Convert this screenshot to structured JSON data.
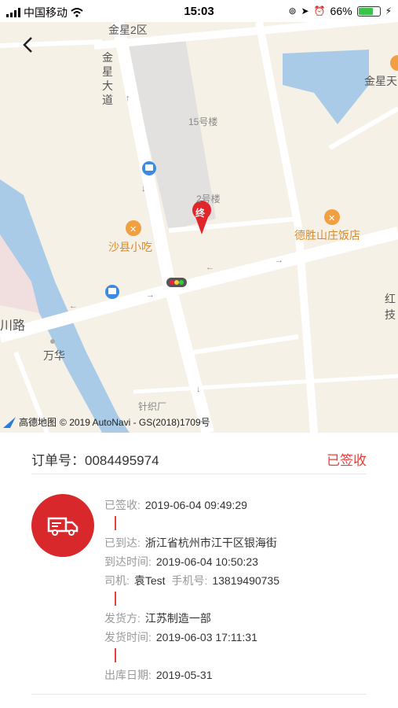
{
  "status_bar": {
    "carrier": "中国移动",
    "time": "15:03",
    "battery": "66%",
    "battery_level": 0.66
  },
  "map": {
    "labels": {
      "jinxing_2qu": "金星2区",
      "jinxing_dadao": "金星大道",
      "jinxing_tian": "金星天",
      "building_15": "15号楼",
      "building_2": "2号楼",
      "shaxian": "沙县小吃",
      "desheng": "德胜山庄饭店",
      "chuanlu": "川路",
      "wanhua": "万华",
      "hong": "红",
      "ji": "技",
      "zhenzhichang": "针织厂",
      "end_marker": "终"
    },
    "attribution_logo": "高德地图",
    "attribution": "© 2019 AutoNavi - GS(2018)1709号"
  },
  "order": {
    "label": "订单号：",
    "number": "0084495974",
    "status": "已签收"
  },
  "timeline": {
    "signed_key": "已签收:",
    "signed_time": "2019-06-04 09:49:29",
    "arrived_key": "已到达:",
    "arrived_place": "浙江省杭州市江干区银海街",
    "arrival_time_key": "到达时间:",
    "arrival_time": "2019-06-04 10:50:23",
    "driver_key": "司机:",
    "driver_name": "袁Test",
    "phone_key": "手机号:",
    "phone": "13819490735",
    "shipper_key": "发货方:",
    "shipper": "江苏制造一部",
    "ship_time_key": "发货时间:",
    "ship_time": "2019-06-03 17:11:31",
    "out_date_key": "出库日期:",
    "out_date": "2019-05-31"
  },
  "colors": {
    "accent_red": "#e8403c",
    "truck_badge": "#d8282c",
    "map_bg": "#f6f1e6",
    "water": "#a9cbe8"
  },
  "icons": [
    "back-arrow-icon",
    "bus-stop-icon",
    "restaurant-icon",
    "destination-marker-icon",
    "traffic-light-icon",
    "truck-icon",
    "wifi-icon",
    "signal-icon"
  ]
}
